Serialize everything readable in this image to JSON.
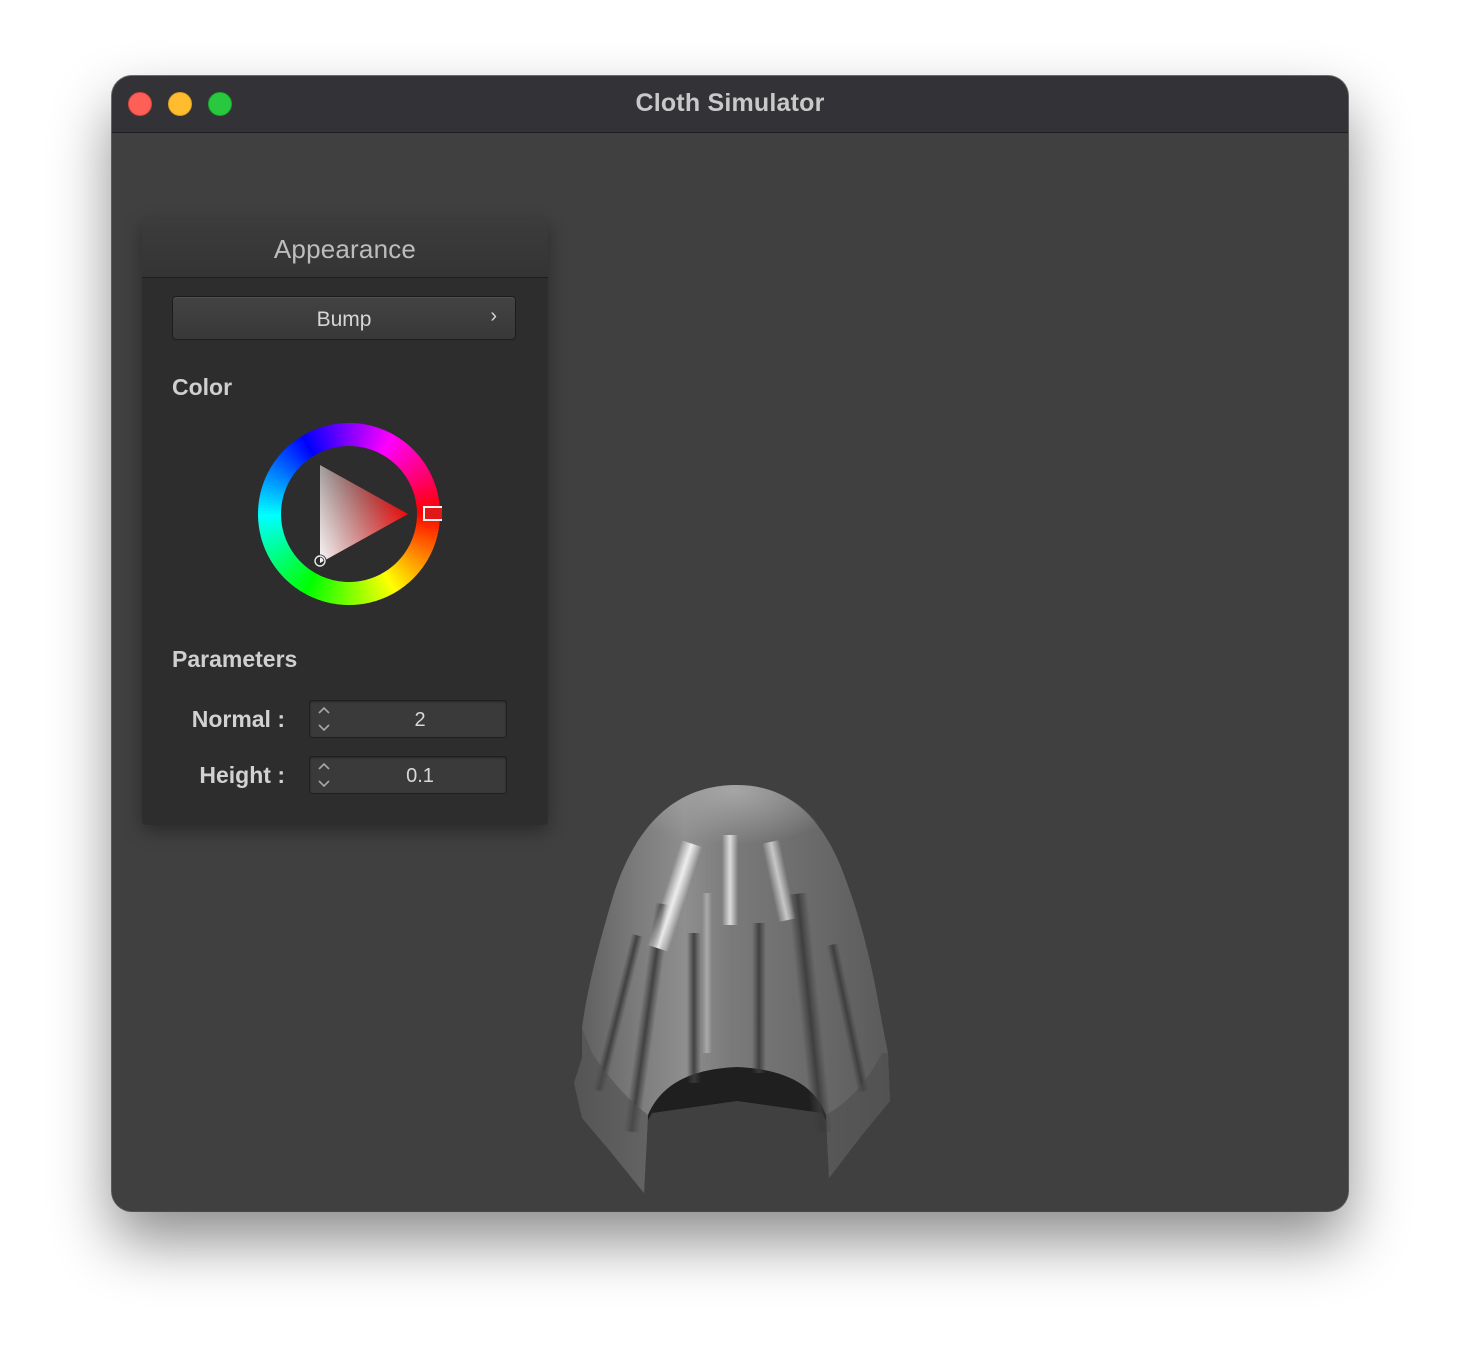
{
  "window": {
    "title": "Cloth Simulator"
  },
  "panel": {
    "title": "Appearance",
    "mode_button": {
      "label": "Bump",
      "icon": "chevron-right-icon"
    },
    "color_section": {
      "label": "Color",
      "selected_hue": "#ff0000"
    },
    "parameters_section": {
      "label": "Parameters",
      "fields": [
        {
          "label": "Normal :",
          "value": "2"
        },
        {
          "label": "Height :",
          "value": "0.1"
        }
      ]
    }
  },
  "colors": {
    "window_background": "#404040",
    "panel_background": "#2d2d2d",
    "cloth": "#7a7a7a"
  }
}
